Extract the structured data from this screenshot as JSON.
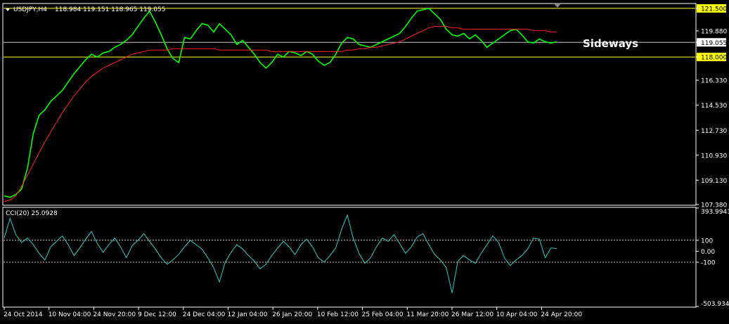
{
  "header": {
    "symbol_info": "USDJPY,H4",
    "quote_values": "118.984 119.151 118.965 119.055",
    "indicator_label": "CCI(20) 25.0928"
  },
  "annotation": "Sideways",
  "colors": {
    "background": "#000000",
    "price": "#00ff00",
    "moving_average": "#ff2020",
    "cci": "#30c8c8",
    "level_lines": "#ffff00",
    "current_price_line": "#c8c8c8",
    "axis": "#ffffff",
    "level_label_bg": "#ffff00",
    "current_label_bg": "#ffffff"
  },
  "chart_data": [
    {
      "type": "line",
      "name": "price",
      "ylim": [
        107.38,
        121.8
      ],
      "y_ticks": [
        "121.500",
        "119.880",
        "119.055",
        "118.000",
        "116.330",
        "114.530",
        "112.730",
        "110.930",
        "109.130",
        "107.380"
      ],
      "highlighted_levels": [
        121.5,
        118.0
      ],
      "current_price": 119.055,
      "x_labels": [
        "24 Oct 2014",
        "10 Nov 04:00",
        "24 Nov 20:00",
        "9 Dec 12:00",
        "24 Dec 04:00",
        "12 Jan 04:00",
        "26 Jan 20:00",
        "10 Feb 12:00",
        "25 Feb 04:00",
        "11 Mar 20:00",
        "26 Mar 12:00",
        "10 Apr 04:00",
        "24 Apr 20:00"
      ],
      "series": [
        {
          "values": [
            108.0,
            107.9,
            108.1,
            108.5,
            110.0,
            112.5,
            113.8,
            114.2,
            114.8,
            115.2,
            115.6,
            116.2,
            116.8,
            117.3,
            117.8,
            118.2,
            118.0,
            118.3,
            118.4,
            118.7,
            118.9,
            119.2,
            119.6,
            120.2,
            120.8,
            121.3,
            120.5,
            119.6,
            118.6,
            117.9,
            117.6,
            119.4,
            119.3,
            119.9,
            120.4,
            120.3,
            119.8,
            120.4,
            120.0,
            119.6,
            118.9,
            119.2,
            118.7,
            118.2,
            117.6,
            117.2,
            117.6,
            118.2,
            118.0,
            118.4,
            118.3,
            118.1,
            118.4,
            118.2,
            117.7,
            117.4,
            117.6,
            118.2,
            119.0,
            119.4,
            119.3,
            118.9,
            118.8,
            118.7,
            118.9,
            119.1,
            119.3,
            119.5,
            119.7,
            120.2,
            120.8,
            121.3,
            121.4,
            121.5,
            121.1,
            120.7,
            120.0,
            119.6,
            119.5,
            119.7,
            119.3,
            119.6,
            119.2,
            118.7,
            119.0,
            119.3,
            119.6,
            119.9,
            120.0,
            119.6,
            119.1,
            119.0,
            119.3,
            119.1,
            119.0,
            119.1
          ]
        },
        {
          "values": [
            107.6,
            107.7,
            108.0,
            108.7,
            109.5,
            110.3,
            111.1,
            111.9,
            112.6,
            113.3,
            114.0,
            114.6,
            115.2,
            115.7,
            116.2,
            116.6,
            116.9,
            117.2,
            117.4,
            117.6,
            117.8,
            118.0,
            118.2,
            118.3,
            118.4,
            118.5,
            118.5,
            118.5,
            118.5,
            118.6,
            118.6,
            118.6,
            118.6,
            118.6,
            118.6,
            118.6,
            118.6,
            118.5,
            118.5,
            118.5,
            118.5,
            118.5,
            118.5,
            118.5,
            118.5,
            118.5,
            118.4,
            118.4,
            118.4,
            118.4,
            118.4,
            118.4,
            118.4,
            118.4,
            118.4,
            118.4,
            118.4,
            118.4,
            118.4,
            118.5,
            118.5,
            118.6,
            118.6,
            118.7,
            118.7,
            118.8,
            118.9,
            119.0,
            119.1,
            119.3,
            119.5,
            119.7,
            119.9,
            120.1,
            120.2,
            120.2,
            120.2,
            120.1,
            120.1,
            120.0,
            120.0,
            120.0,
            120.0,
            120.0,
            120.0,
            120.0,
            120.0,
            120.0,
            120.0,
            120.0,
            120.0,
            119.9,
            119.9,
            119.9,
            119.8,
            119.8
          ]
        }
      ]
    },
    {
      "type": "line",
      "name": "cci",
      "ylim": [
        -503.9344,
        393.9941
      ],
      "y_ticks": [
        "393.9941",
        "100",
        "0.00",
        "-100",
        "-503.9344"
      ],
      "highlighted_levels": [
        100,
        -100
      ],
      "series": [
        {
          "values": [
            120,
            300,
            150,
            80,
            120,
            60,
            -20,
            -80,
            40,
            90,
            140,
            60,
            -40,
            30,
            110,
            180,
            70,
            -10,
            60,
            120,
            40,
            -60,
            50,
            100,
            160,
            90,
            20,
            -60,
            -120,
            -80,
            -30,
            40,
            100,
            60,
            20,
            -60,
            -150,
            -280,
            -100,
            -10,
            60,
            20,
            -40,
            -90,
            -160,
            -120,
            -40,
            30,
            90,
            40,
            -30,
            60,
            110,
            40,
            -60,
            -100,
            -40,
            30,
            200,
            330,
            120,
            -20,
            -110,
            -60,
            40,
            120,
            90,
            150,
            70,
            -20,
            40,
            130,
            160,
            60,
            -30,
            -80,
            -150,
            -380,
            -90,
            -40,
            -80,
            -110,
            -20,
            60,
            140,
            80,
            -60,
            -130,
            -80,
            -40,
            20,
            120,
            110,
            -60,
            30,
            25
          ]
        }
      ]
    }
  ]
}
